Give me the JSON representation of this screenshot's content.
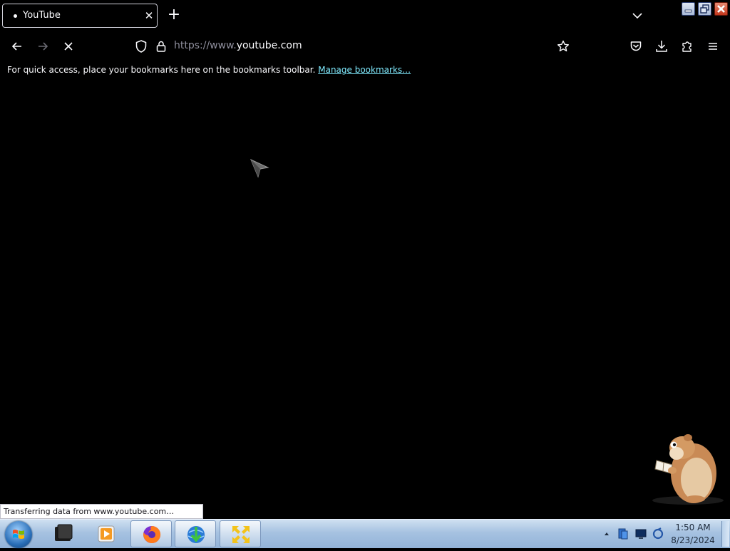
{
  "browser": {
    "tab": {
      "title": "YouTube"
    },
    "url": {
      "prefix": "https://www.",
      "host": "youtube.com"
    },
    "bookmarks_bar": {
      "message": "For quick access, place your bookmarks here on the bookmarks toolbar.",
      "manage_link": "Manage bookmarks…"
    },
    "status": "Transferring data from www.youtube.com…"
  },
  "taskbar": {
    "clock": {
      "time": "1:50 AM",
      "date": "8/23/2024"
    }
  },
  "colors": {
    "background": "#000000",
    "link": "#80ebff",
    "taskbar": "#a6c2e1"
  }
}
